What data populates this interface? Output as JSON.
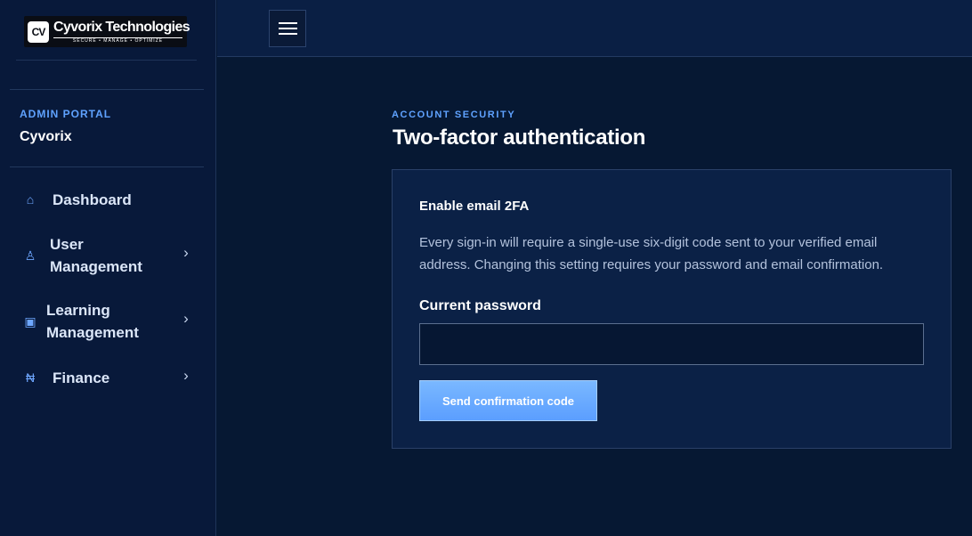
{
  "brand": {
    "mark": "CV",
    "name": "Cyvorix Technologies",
    "tagline": "SECURE • MANAGE • OPTIMIZE"
  },
  "sidebar": {
    "portal_label": "ADMIN PORTAL",
    "portal_name": "Cyvorix",
    "items": [
      {
        "label": "Dashboard",
        "icon": "home-icon",
        "glyph": "⌂"
      },
      {
        "label": "User Management",
        "icon": "user-icon",
        "glyph": "♙",
        "chevron": "›"
      },
      {
        "label": "Learning Management",
        "icon": "book-icon",
        "glyph": "▣",
        "chevron": "›"
      },
      {
        "label": "Finance",
        "icon": "currency-icon",
        "glyph": "₦",
        "chevron": "›"
      }
    ]
  },
  "topbar": {
    "menu_icon": "hamburger-menu-icon"
  },
  "main": {
    "eyebrow": "ACCOUNT SECURITY",
    "title": "Two-factor authentication",
    "card": {
      "title": "Enable email 2FA",
      "description": "Every sign-in will require a single-use six-digit code sent to your verified email address. Changing this setting requires your password and email confirmation.",
      "password_label": "Current password",
      "password_value": "",
      "button_label": "Send confirmation code"
    }
  },
  "colors": {
    "background": "#061833",
    "sidebar": "#08193a",
    "topbar": "#0a1f44",
    "card": "#0b2146",
    "accent": "#5fa2ff",
    "button": "#6aacff"
  }
}
